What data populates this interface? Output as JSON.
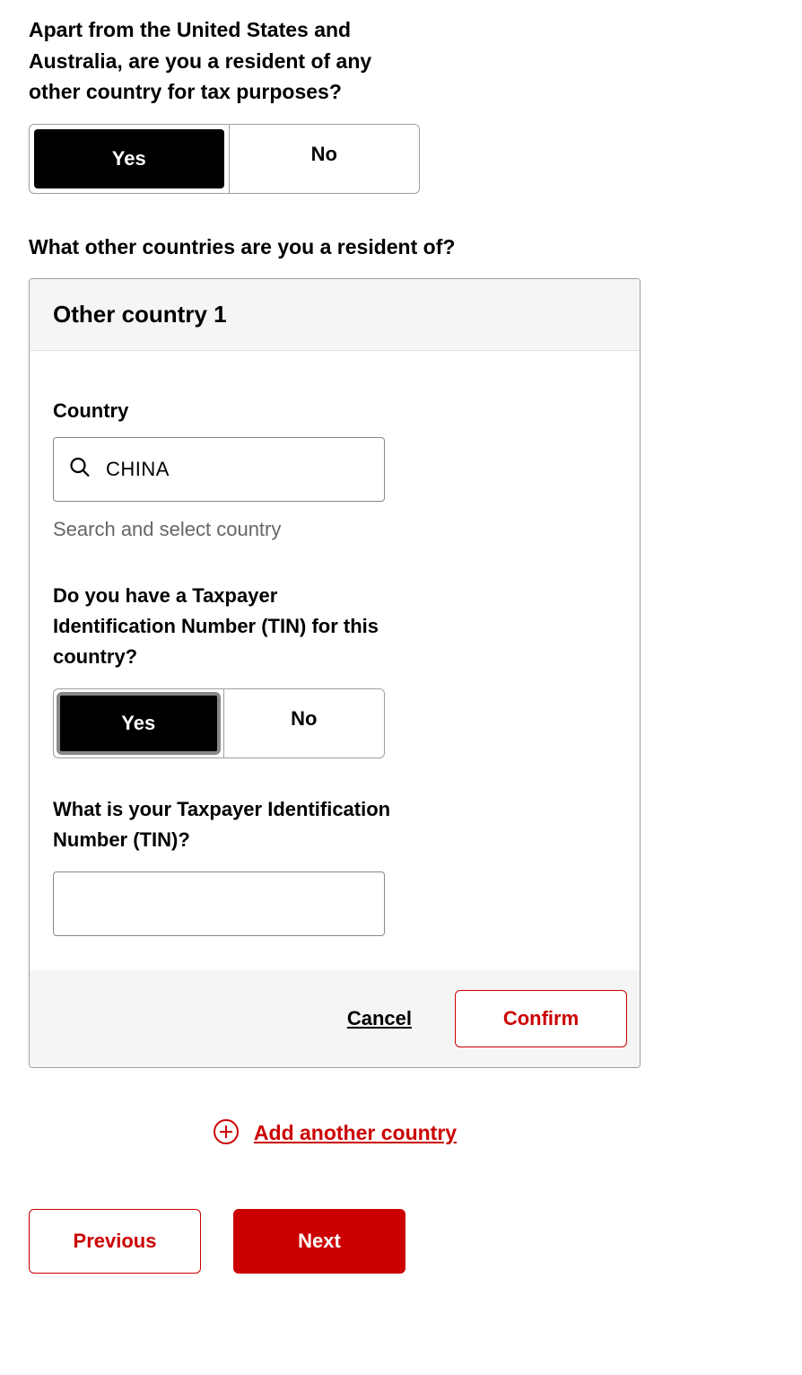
{
  "question1": {
    "label": "Apart from the United States and Australia, are you a resident of any other country for tax purposes?",
    "yes": "Yes",
    "no": "No"
  },
  "question2": {
    "label": "What other countries are you a resident of?"
  },
  "panel": {
    "title": "Other country 1",
    "country_label": "Country",
    "country_value": "CHINA",
    "country_hint": "Search and select country",
    "tin_question": "Do you have a Taxpayer Identification Number (TIN) for this country?",
    "tin_yes": "Yes",
    "tin_no": "No",
    "tin_label": "What is your Taxpayer Identification Number (TIN)?",
    "tin_value": "",
    "cancel": "Cancel",
    "confirm": "Confirm"
  },
  "add_country": "Add another country",
  "nav": {
    "previous": "Previous",
    "next": "Next"
  }
}
